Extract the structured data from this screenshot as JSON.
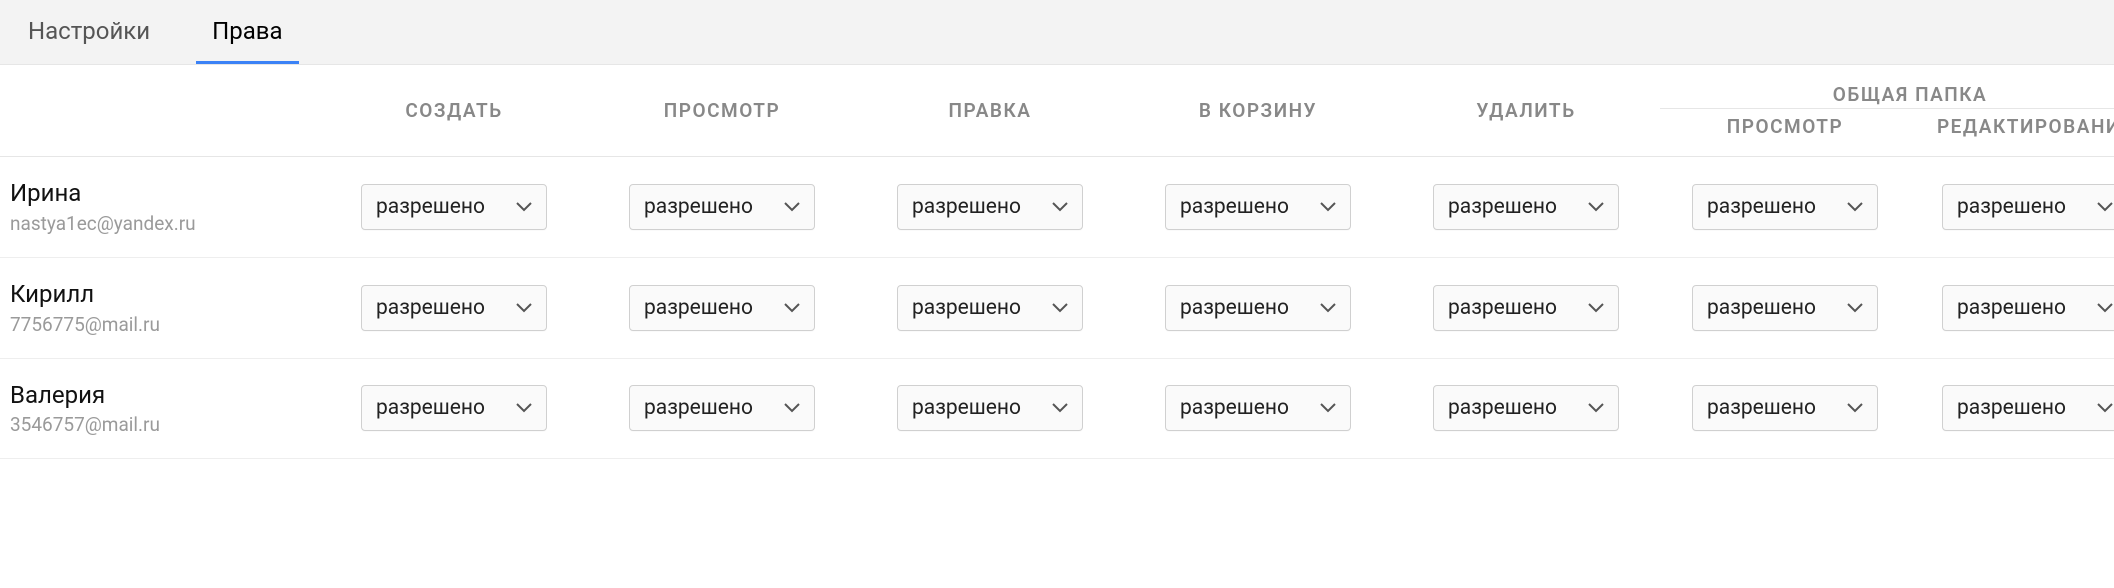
{
  "tabs": [
    {
      "label": "Настройки",
      "active": false
    },
    {
      "label": "Права",
      "active": true
    }
  ],
  "columns": {
    "create": "СОЗДАТЬ",
    "view": "ПРОСМОТР",
    "edit": "ПРАВКА",
    "trash": "В КОРЗИНУ",
    "delete": "УДАЛИТЬ",
    "shared_group": "ОБЩАЯ ПАПКА",
    "shared_view": "ПРОСМОТР",
    "shared_edit": "РЕДАКТИРОВАНИЕ"
  },
  "option_allowed": "разрешено",
  "users": [
    {
      "name": "Ирина",
      "email": "nastya1ec@yandex.ru",
      "perms": {
        "create": "разрешено",
        "view": "разрешено",
        "edit": "разрешено",
        "trash": "разрешено",
        "delete": "разрешено",
        "shared_view": "разрешено",
        "shared_edit": "разрешено"
      }
    },
    {
      "name": "Кирилл",
      "email": "7756775@mail.ru",
      "perms": {
        "create": "разрешено",
        "view": "разрешено",
        "edit": "разрешено",
        "trash": "разрешено",
        "delete": "разрешено",
        "shared_view": "разрешено",
        "shared_edit": "разрешено"
      }
    },
    {
      "name": "Валерия",
      "email": "3546757@mail.ru",
      "perms": {
        "create": "разрешено",
        "view": "разрешено",
        "edit": "разрешено",
        "trash": "разрешено",
        "delete": "разрешено",
        "shared_view": "разрешено",
        "shared_edit": "разрешено"
      }
    }
  ]
}
